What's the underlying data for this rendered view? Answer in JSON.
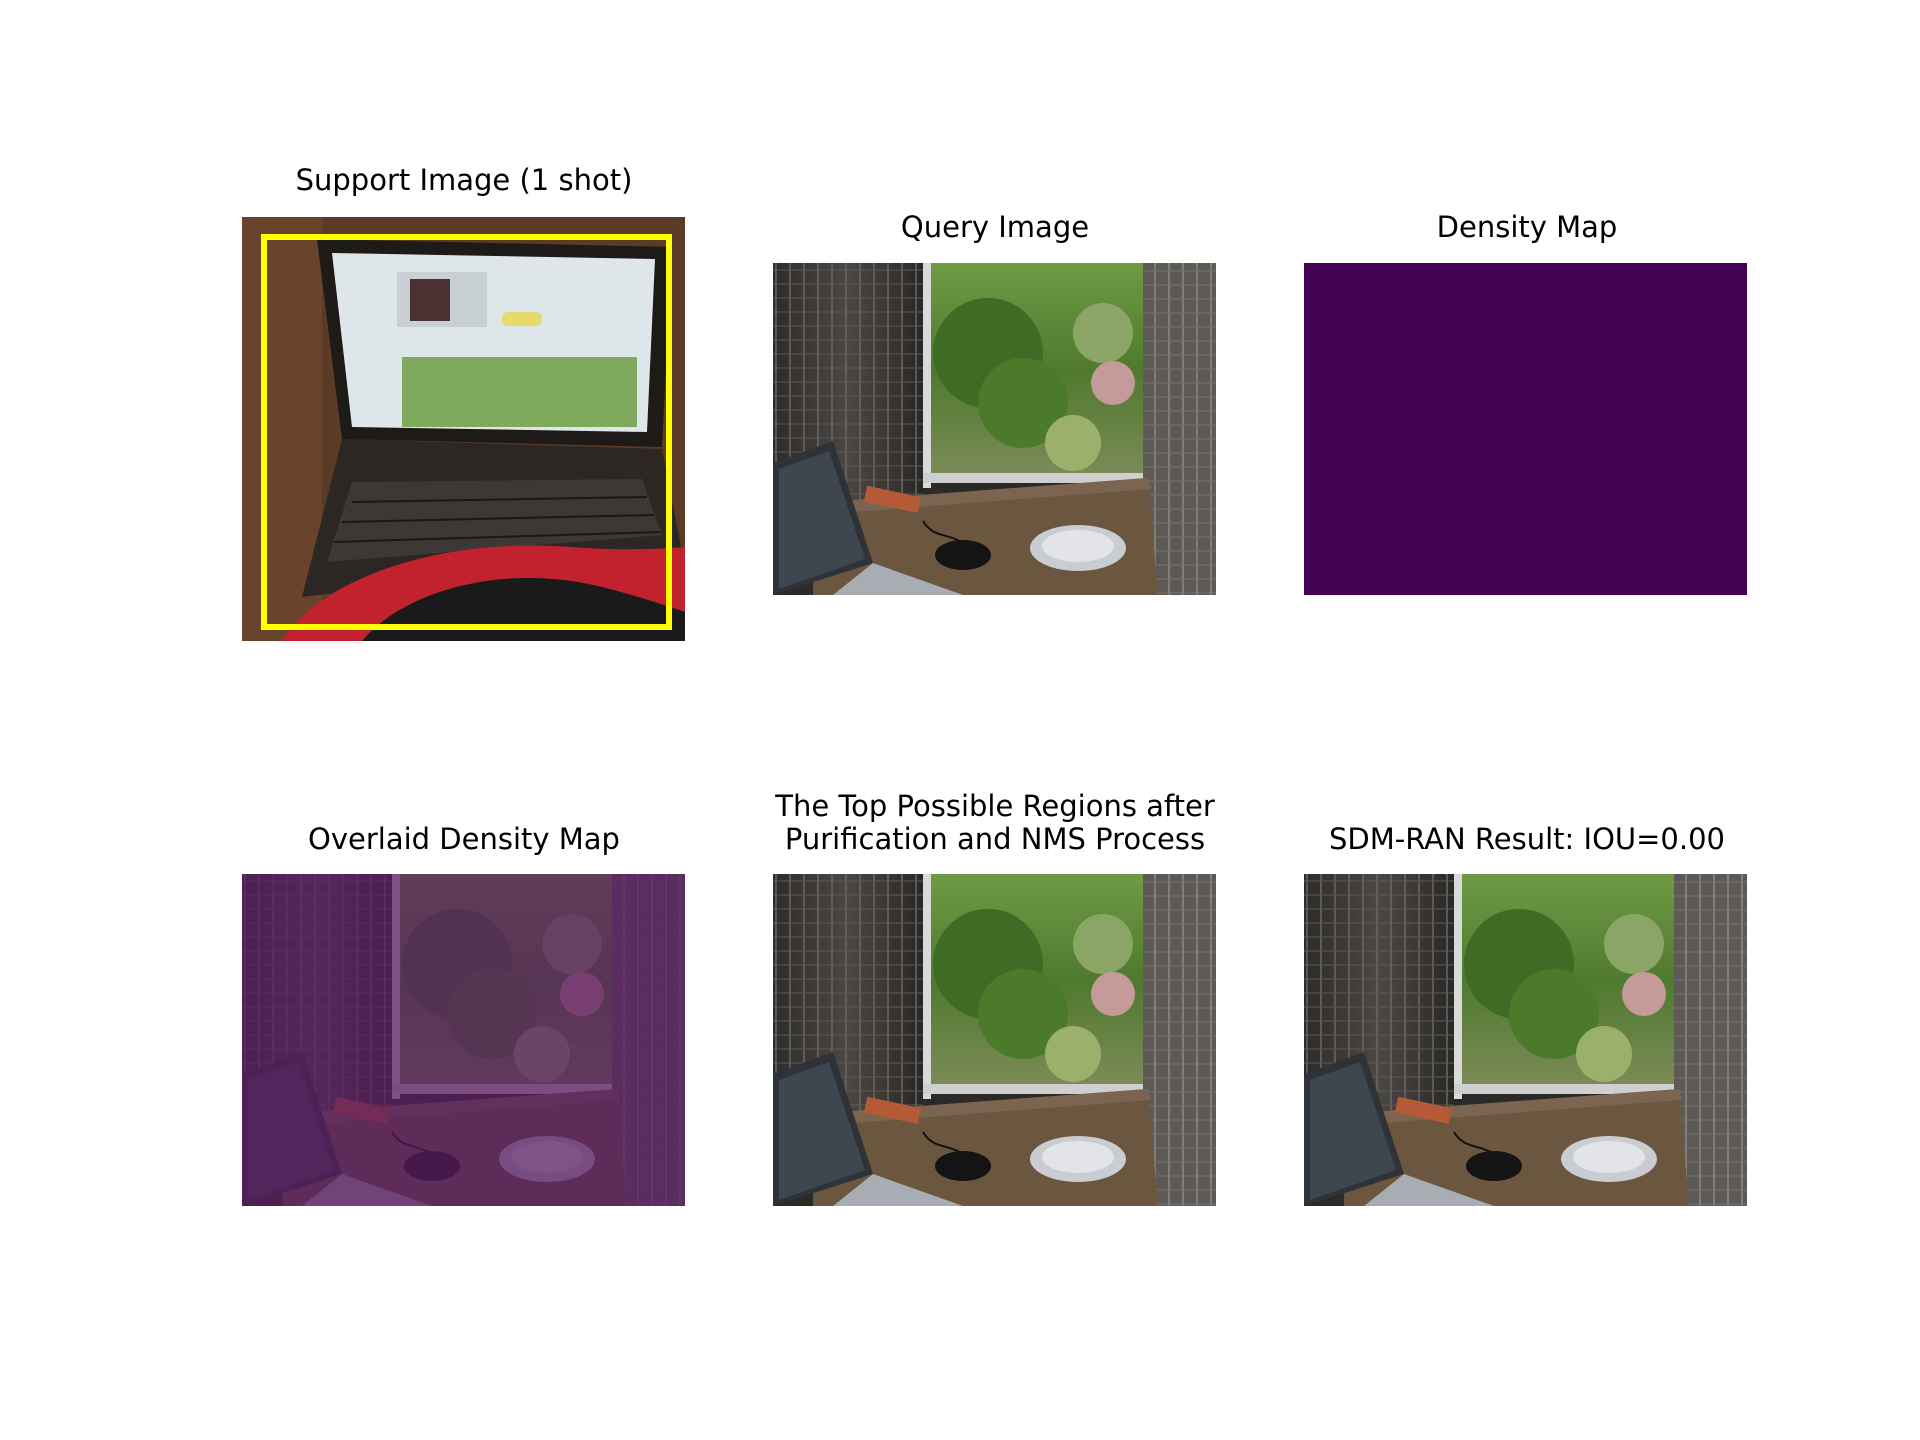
{
  "figure": {
    "panels": [
      {
        "title": "Support Image (1 shot)",
        "image": "laptop-photo-with-yellow-box"
      },
      {
        "title": "Query Image",
        "image": "window-desk-photo"
      },
      {
        "title": "Density Map",
        "image": "flat-density-map"
      },
      {
        "title": "Overlaid Density Map",
        "image": "window-desk-photo-purple-overlay"
      },
      {
        "title": "The Top Possible Regions after\nPurification and NMS Process",
        "image": "window-desk-photo"
      },
      {
        "title": "SDM-RAN Result: IOU=0.00",
        "image": "window-desk-photo"
      }
    ],
    "colors": {
      "bounding_box": "#ffff00",
      "density_flat": "#440154",
      "overlay": "#5a1a63"
    }
  }
}
